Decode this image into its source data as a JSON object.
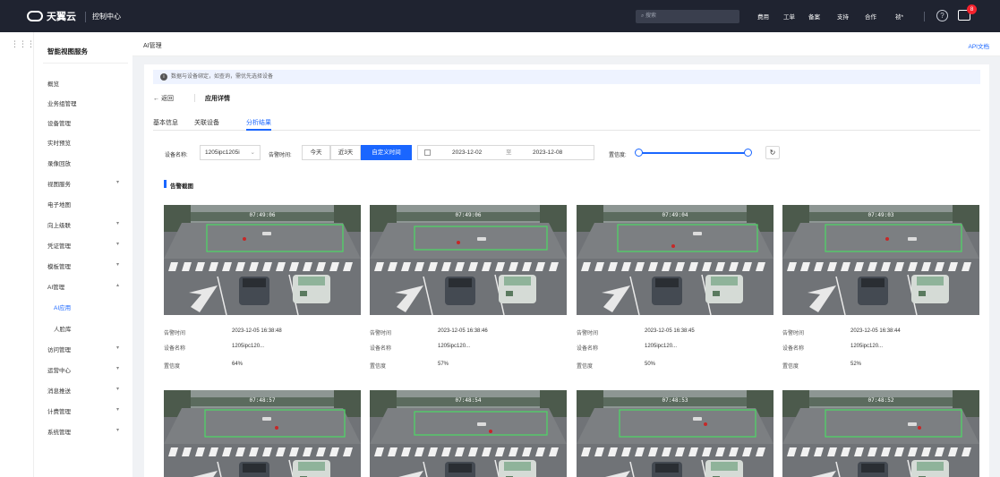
{
  "topbar": {
    "brand": "天翼云",
    "console": "控制中心",
    "search_placeholder": "搜索",
    "nav": [
      "费用",
      "工单",
      "备案",
      "支持",
      "合作",
      "祯*"
    ],
    "notification_count": "8",
    "bg_color": "#1f2330"
  },
  "sidebar": {
    "title": "智能视图服务",
    "items": [
      {
        "label": "概览",
        "has_children": false
      },
      {
        "label": "业务组管理",
        "has_children": false
      },
      {
        "label": "设备管理",
        "has_children": false
      },
      {
        "label": "实时预览",
        "has_children": false
      },
      {
        "label": "录像回放",
        "has_children": false
      },
      {
        "label": "视图服务",
        "has_children": true
      },
      {
        "label": "电子地图",
        "has_children": false
      },
      {
        "label": "向上级联",
        "has_children": true
      },
      {
        "label": "凭证管理",
        "has_children": true
      },
      {
        "label": "模板管理",
        "has_children": true
      },
      {
        "label": "AI管理",
        "has_children": true,
        "expanded": true
      },
      {
        "label": "AI应用",
        "sub": true,
        "active": true
      },
      {
        "label": "人脸库",
        "sub": true
      },
      {
        "label": "访问管理",
        "has_children": true
      },
      {
        "label": "运营中心",
        "has_children": true
      },
      {
        "label": "消息推送",
        "has_children": true
      },
      {
        "label": "计费管理",
        "has_children": true
      },
      {
        "label": "系统管理",
        "has_children": true
      }
    ]
  },
  "breadcrumb": "AI管理",
  "api_doc": "API文档",
  "notice": "数据与设备绑定，如查询，需优先选择设备",
  "back": "← 返回",
  "page_title": "应用详情",
  "tabs": [
    {
      "label": "基本信息",
      "active": false
    },
    {
      "label": "关联设备",
      "active": false
    },
    {
      "label": "分析结果",
      "active": true
    }
  ],
  "filters": {
    "device_label": "设备名称:",
    "device_value": "1205ipc1205i",
    "alarm_time_label": "告警时间:",
    "time_options": [
      {
        "label": "今天",
        "active": false
      },
      {
        "label": "近3天",
        "active": false
      },
      {
        "label": "自定义时间",
        "active": true
      }
    ],
    "date_start": "2023-12-02",
    "date_sep": "至",
    "date_end": "2023-12-08",
    "confidence_label": "置信度:",
    "confidence_range": [
      0,
      1
    ]
  },
  "section_title": "告警截图",
  "cards_meta_keys": {
    "time": "告警时间",
    "device": "设备名称",
    "confidence": "置信度"
  },
  "cards": [
    {
      "overlay_time": "07:49:06",
      "time": "2023-12-05 16:38:48",
      "device": "1205ipc120...",
      "confidence": "64%"
    },
    {
      "overlay_time": "07:49:06",
      "time": "2023-12-05 16:38:46",
      "device": "1205ipc120...",
      "confidence": "57%"
    },
    {
      "overlay_time": "07:49:04",
      "time": "2023-12-05 16:38:45",
      "device": "1205ipc120...",
      "confidence": "50%"
    },
    {
      "overlay_time": "07:49:03",
      "time": "2023-12-05 16:38:44",
      "device": "1205ipc120...",
      "confidence": "52%"
    },
    {
      "overlay_time": "07:48:57",
      "time": "",
      "device": "",
      "confidence": ""
    },
    {
      "overlay_time": "07:48:54",
      "time": "",
      "device": "",
      "confidence": ""
    },
    {
      "overlay_time": "07:48:53",
      "time": "",
      "device": "",
      "confidence": ""
    },
    {
      "overlay_time": "07:48:52",
      "time": "",
      "device": "",
      "confidence": ""
    }
  ],
  "colors": {
    "accent": "#1a66ff",
    "detection_box": "#4cd964"
  }
}
